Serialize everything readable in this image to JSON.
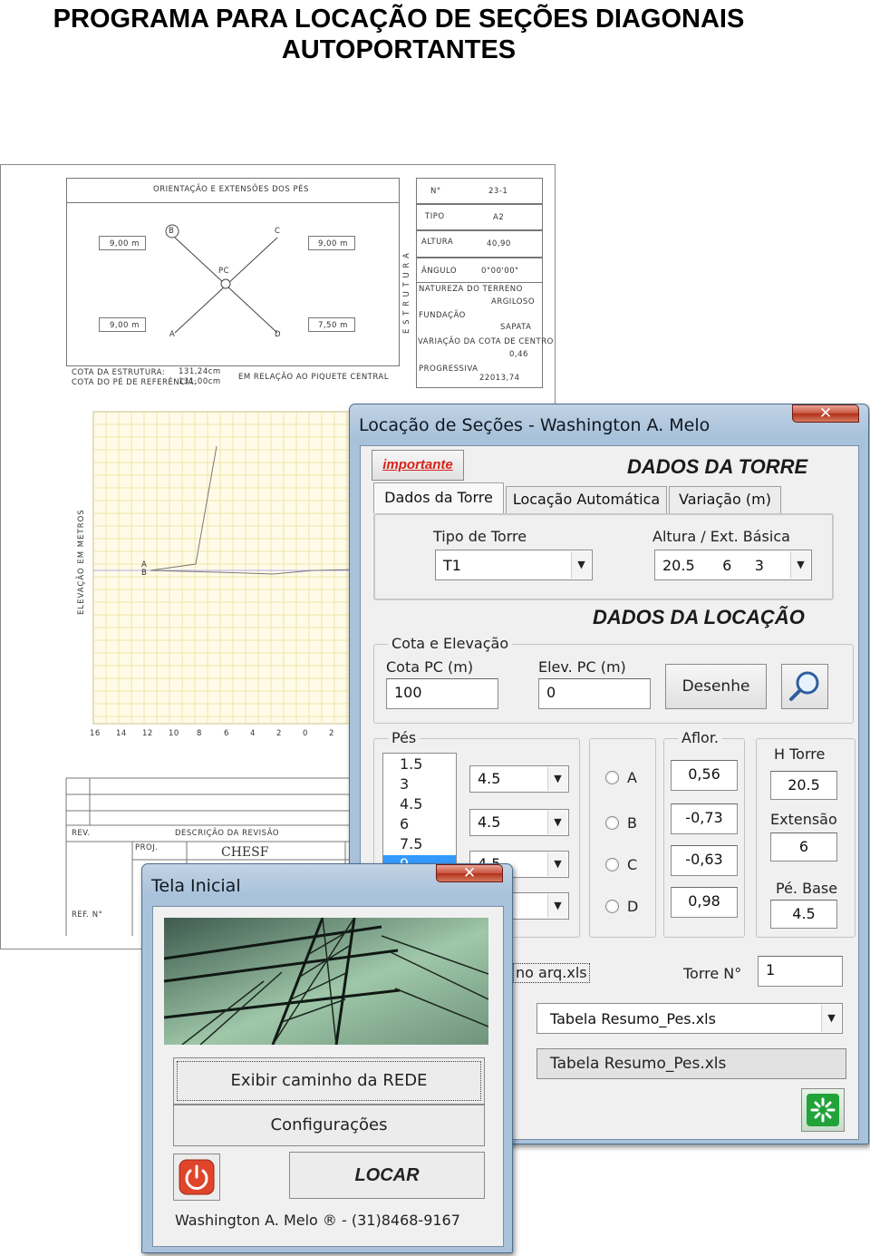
{
  "page": {
    "title_line1": "PROGRAMA PARA LOCAÇÃO DE SEÇÕES DIAGONAIS",
    "title_line2": "AUTOPORTANTES"
  },
  "drawing": {
    "orientation_header": "ORIENTAÇÃO E EXTENSÕES DOS PÉS",
    "legs": {
      "b_ext": "9,00",
      "c_ext": "9,00",
      "a_ext": "9,00",
      "d_ext": "7,50",
      "unit": "m"
    },
    "points": {
      "a": "A",
      "b": "B",
      "c": "C",
      "d": "D",
      "pc": "PC"
    },
    "cota_estrutura_label": "COTA DA ESTRUTURA:",
    "cota_estrutura_value": "131,24cm",
    "cota_pe_label": "COTA DO PÉ DE REFERÊNCIA:",
    "cota_pe_value": "131,00cm",
    "em_relacao": "EM RELAÇÃO AO PIQUETE CENTRAL",
    "estrutura_vertical": "E S T R U T U R A",
    "info": {
      "n_label": "N°",
      "n_value": "23-1",
      "tipo_label": "TIPO",
      "tipo_value": "A2",
      "altura_label": "ALTURA",
      "altura_value": "40,90",
      "angulo_label": "ÂNGULO",
      "angulo_value": "0°00'00\"",
      "natureza_label": "NATUREZA DO TERRENO",
      "natureza_value": "ARGILOSO",
      "fundacao_label": "FUNDAÇÃO",
      "fundacao_value": "SAPATA",
      "variacao_label": "VARIAÇÃO DA COTA DE CENTRO",
      "variacao_value": "0,46",
      "progressiva_label": "PROGRESSIVA",
      "progressiva_value": "22013,74"
    },
    "elevation_axis_label": "ELEVAÇÃO EM METROS",
    "profile_points": [
      "A",
      "B"
    ],
    "x_ticks": [
      "16",
      "14",
      "12",
      "10",
      "8",
      "6",
      "4",
      "2",
      "0",
      "2"
    ],
    "rev_label": "REV.",
    "descricao_label": "DESCRIÇÃO DA REVISÃO",
    "proj_label": "PROJ.",
    "company": "CHESF",
    "ref_label": "REF. N°"
  },
  "main_window": {
    "title": "Locação de Seções - Washington A. Melo",
    "close_label": "✕",
    "importante_button": "importante",
    "header_torre": "DADOS DA TORRE",
    "tabs": [
      "Dados da Torre",
      "Locação Automática",
      "Variação (m)"
    ],
    "tipo_torre_label": "Tipo de Torre",
    "tipo_torre_value": "T1",
    "altura_label": "Altura / Ext. Básica",
    "altura_value": "20.5      6     3",
    "header_locacao": "DADOS DA LOCAÇÃO",
    "cota_group_label": "Cota e Elevação",
    "cota_pc_label": "Cota PC (m)",
    "cota_pc_value": "100",
    "elev_pc_label": "Elev. PC (m)",
    "elev_pc_value": "0",
    "desenhe_button": "Desenhe",
    "pes_group_label": "Pés",
    "pes_list": [
      "1.5",
      "3",
      "4.5",
      "6",
      "7.5",
      "9"
    ],
    "pes_combos": [
      "4.5",
      "4.5",
      "4.5",
      ""
    ],
    "radios": [
      "A",
      "B",
      "C",
      "D"
    ],
    "aflor_group_label": "Aflor.",
    "aflor_values": [
      "0,56",
      "-0,73",
      "-0,63",
      "0,98"
    ],
    "h_torre_label": "H Torre",
    "h_torre_value": "20.5",
    "extensao_label": "Extensão",
    "extensao_value": "6",
    "pe_base_label": "Pé. Base",
    "pe_base_value": "4.5",
    "arq_label": "no arq.xls",
    "torre_n_label": "Torre N°",
    "torre_n_value": "1",
    "tabela_combo_value": "Tabela Resumo_Pes.xls",
    "tabela_button": "Tabela Resumo_Pes.xls"
  },
  "splash_window": {
    "title": "Tela Inicial",
    "close_label": "✕",
    "exibir_button": "Exibir caminho da REDE",
    "config_button": "Configurações",
    "locar_button": "LOCAR",
    "footer": "Washington A. Melo ® - (31)8468-9167"
  }
}
